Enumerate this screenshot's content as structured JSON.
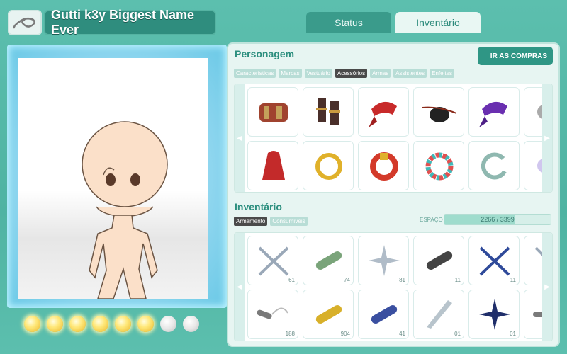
{
  "header": {
    "player_name": "Gutti k3y Biggest Name Ever",
    "logo_icon": "leaf-village-icon"
  },
  "tabs": [
    {
      "label": "Status",
      "active": false
    },
    {
      "label": "Inventário",
      "active": true
    }
  ],
  "character": {
    "energy_orbs": {
      "lit": 6,
      "total": 8
    }
  },
  "personagem": {
    "title": "Personagem",
    "shop_button": "IR AS COMPRAS",
    "filters": [
      "Características",
      "Marcas",
      "Vestuário",
      "Acessórios",
      "Armas",
      "Assistentes",
      "Enfeites"
    ],
    "active_filter": "Acessórios",
    "items": [
      {
        "icon": "wrist-guard-icon"
      },
      {
        "icon": "boots-icon"
      },
      {
        "icon": "red-bandana-icon"
      },
      {
        "icon": "eyepatch-icon"
      },
      {
        "icon": "purple-bandana-icon"
      },
      {
        "icon": "partial-item-icon"
      },
      {
        "icon": "red-cloak-icon"
      },
      {
        "icon": "gold-ring-icon"
      },
      {
        "icon": "red-bracelet-icon"
      },
      {
        "icon": "bead-bracelet-icon"
      },
      {
        "icon": "silver-ring-icon"
      },
      {
        "icon": "partial-item-icon"
      }
    ]
  },
  "inventario": {
    "title": "Inventário",
    "filters": [
      "Armamento",
      "Consumíveis"
    ],
    "active_filter": "Armamento",
    "space_label": "ESPAÇO",
    "space_text": "2266 / 3399",
    "space_used": 2266,
    "space_total": 3399,
    "items": [
      {
        "icon": "crossed-kunai-icon",
        "count": "61"
      },
      {
        "icon": "green-scroll-icon",
        "count": "74"
      },
      {
        "icon": "shuriken-icon",
        "count": "81"
      },
      {
        "icon": "black-scroll-icon",
        "count": "11"
      },
      {
        "icon": "crossed-blue-kunai-icon",
        "count": "11"
      },
      {
        "icon": "partial-kunai-icon",
        "count": ""
      },
      {
        "icon": "nunchaku-icon",
        "count": "188"
      },
      {
        "icon": "gold-scroll-icon",
        "count": "904"
      },
      {
        "icon": "blue-scroll-icon",
        "count": "41"
      },
      {
        "icon": "blade-icon",
        "count": "01"
      },
      {
        "icon": "blue-shuriken-icon",
        "count": "01"
      },
      {
        "icon": "partial-nunchaku-icon",
        "count": ""
      }
    ]
  }
}
